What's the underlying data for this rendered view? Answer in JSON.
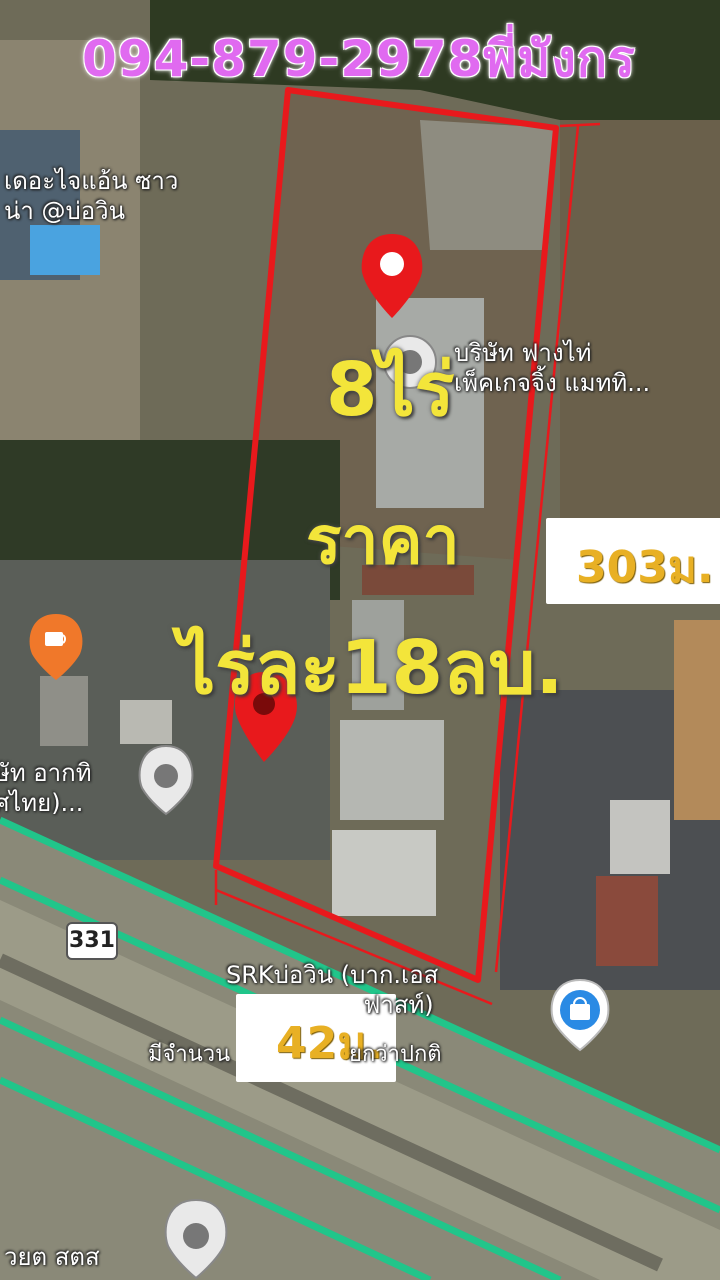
{
  "header": {
    "phone_contact": "094-879-2978พี่มังกร"
  },
  "land": {
    "area": "8ไร่",
    "price_label": "ราคา",
    "price": "ไร่ละ18ลบ.",
    "side_length": "303ม.",
    "front_length": "42ม."
  },
  "places": {
    "resort": "เดอะไจแอ้น ซาว\nน่า @บ่อวิน",
    "company_packaging": "บริษัท ฟางไท่\nเพ็คเกจจิ้ง แมททิ...",
    "company_left": "ษัท อากทิ\nศไทย)...",
    "srk": "SRKบ่อวิน (บาก.เอส\n                  ฟาสท์)",
    "srk_note": "มีจำนวน                 ยกว่าปกติ",
    "bottom_label": "วยต สตส"
  },
  "road": {
    "route_number": "331"
  },
  "colors": {
    "boundary": "#e8191c",
    "phone_text": "#e06af0",
    "headline_text": "#f3e53a",
    "dimension_text": "#e8b024",
    "road_line": "#21c58a"
  },
  "icons": [
    "location-pin-icon",
    "cafe-icon",
    "shopping-bag-icon",
    "poi-icon"
  ]
}
